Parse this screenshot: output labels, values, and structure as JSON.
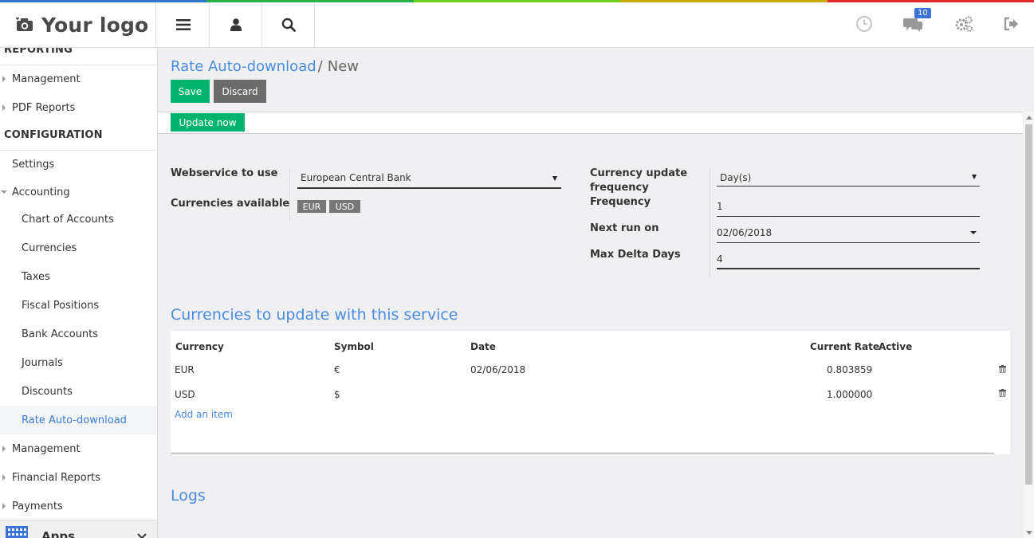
{
  "brand": {
    "logo_text": "Your logo",
    "rainbow": [
      "#2e77d0",
      "#27b24a",
      "#6fcf1d",
      "#c9ab00",
      "#e22a2a"
    ],
    "accent": "#4a8be0",
    "save_color": "#00b46e"
  },
  "topbar": {
    "menu_icon": "hamburger-menu-icon",
    "user_icon": "user-icon",
    "search_icon": "search-icon",
    "clock_icon": "clock-icon",
    "chat_icon": "chat-icon",
    "chat_badge": "10",
    "settings_icon": "gears-icon",
    "logout_icon": "logout-icon"
  },
  "sidebar": {
    "reporting_title": "REPORTING",
    "reporting_items": [
      "Management",
      "PDF Reports"
    ],
    "configuration_title": "CONFIGURATION",
    "settings": "Settings",
    "accounting": "Accounting",
    "accounting_items": [
      "Chart of Accounts",
      "Currencies",
      "Taxes",
      "Fiscal Positions",
      "Bank Accounts",
      "Journals",
      "Discounts",
      "Rate Auto-download"
    ],
    "more_items": [
      "Management",
      "Financial Reports",
      "Payments"
    ],
    "apps": "Apps"
  },
  "breadcrumb": {
    "parent": "Rate Auto-download",
    "separator": "/",
    "current": "New"
  },
  "actions": {
    "save": "Save",
    "discard": "Discard",
    "update_now": "Update now"
  },
  "form": {
    "webservice_label": "Webservice to use",
    "webservice_value": "European Central Bank",
    "currencies_label": "Currencies available",
    "currencies_tags": [
      "EUR",
      "USD"
    ],
    "freq_label": "Currency update frequency",
    "freq_value": "Day(s)",
    "frequency_label": "Frequency",
    "frequency_value": "1",
    "next_run_label": "Next run on",
    "next_run_value": "02/06/2018",
    "max_delta_label": "Max Delta Days",
    "max_delta_value": "4"
  },
  "currencies_section": {
    "title": "Currencies to update with this service",
    "columns": [
      "Currency",
      "Symbol",
      "Date",
      "Current Rate",
      "Active"
    ],
    "rows": [
      {
        "currency": "EUR",
        "symbol": "€",
        "date": "02/06/2018",
        "rate": "0.803859"
      },
      {
        "currency": "USD",
        "symbol": "$",
        "date": "",
        "rate": "1.000000"
      }
    ],
    "add_item": "Add an item"
  },
  "logs_title": "Logs"
}
